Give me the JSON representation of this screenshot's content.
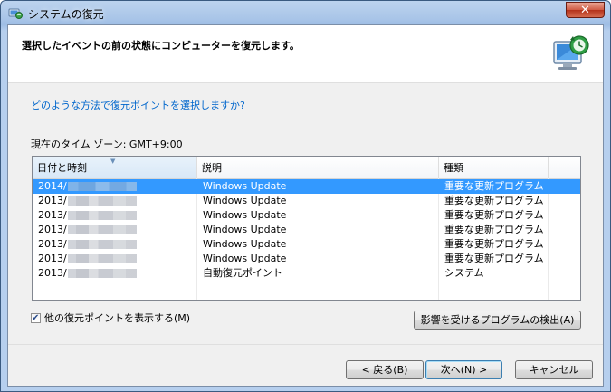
{
  "window": {
    "title": "システムの復元",
    "close_label": "✕"
  },
  "header": {
    "title": "選択したイベントの前の状態にコンピューターを復元します。",
    "icon": "system-restore-monitor-icon"
  },
  "help_link": "どのような方法で復元ポイントを選択しますか?",
  "timezone": "現在のタイム ゾーン: GMT+9:00",
  "list": {
    "columns": [
      "日付と時刻",
      "説明",
      "種類"
    ],
    "rows": [
      {
        "date": "2014/",
        "description": "Windows Update",
        "type": "重要な更新プログラム",
        "selected": true
      },
      {
        "date": "2013/",
        "description": "Windows Update",
        "type": "重要な更新プログラム",
        "selected": false
      },
      {
        "date": "2013/",
        "description": "Windows Update",
        "type": "重要な更新プログラム",
        "selected": false
      },
      {
        "date": "2013/",
        "description": "Windows Update",
        "type": "重要な更新プログラム",
        "selected": false
      },
      {
        "date": "2013/",
        "description": "Windows Update",
        "type": "重要な更新プログラム",
        "selected": false
      },
      {
        "date": "2013/",
        "description": "Windows Update",
        "type": "重要な更新プログラム",
        "selected": false
      },
      {
        "date": "2013/",
        "description": "自動復元ポイント",
        "type": "システム",
        "selected": false
      }
    ]
  },
  "show_more": {
    "label": "他の復元ポイントを表示する(M)",
    "checked": true
  },
  "buttons": {
    "scan": "影響を受けるプログラムの検出(A)",
    "back": "< 戻る(B)",
    "next": "次へ(N) >",
    "cancel": "キャンセル"
  },
  "colors": {
    "selection": "#3399ff",
    "link": "#0066cc"
  }
}
